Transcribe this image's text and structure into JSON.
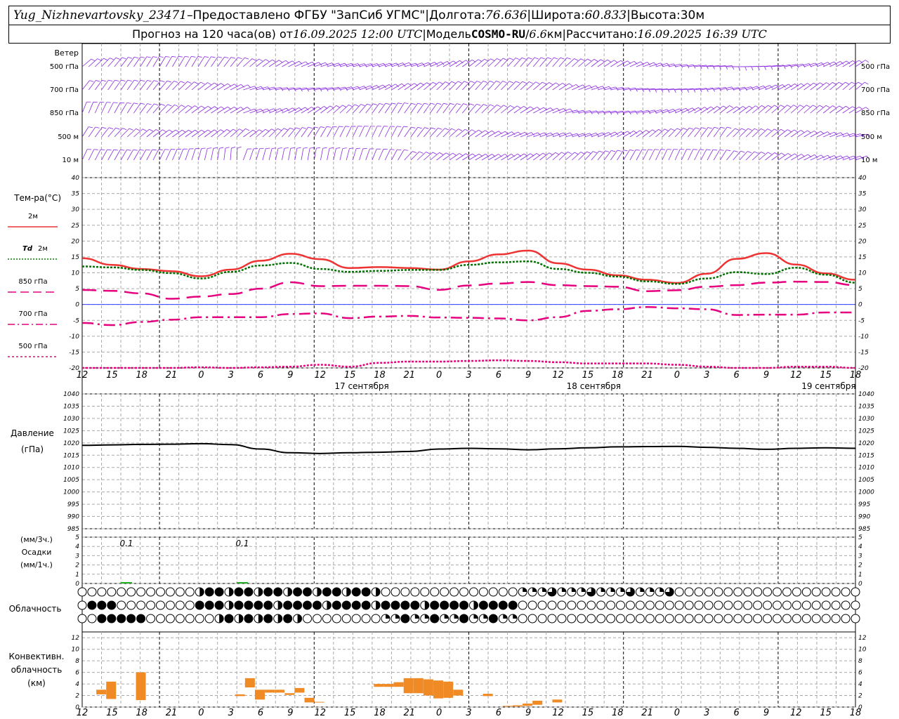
{
  "header": {
    "station": "Yug_Nizhnevartovsky_23471",
    "dash": " – ",
    "provided": "Предоставлено ФГБУ \"ЗапСиб УГМС\"",
    "sep": " | ",
    "lon_label": "Долгота: ",
    "lon": "76.636",
    "lat_label": "Широта: ",
    "lat": "60.833",
    "alt_label": "Высота: ",
    "alt": "30м",
    "forecast_label": "Прогноз на 120 часа(ов) от ",
    "init_time": "16.09.2025 12:00 UTC",
    "model_label": "Модель ",
    "model": "COSMO-RU",
    "res_sep": " / ",
    "res": "6.6",
    "res_unit": "км",
    "calc_label": "Рассчитано: ",
    "calc_time": "16.09.2025 16:39 UTC"
  },
  "wind_panel": {
    "title": "Ветер",
    "levels": [
      "500 гПа",
      "700 гПа",
      "850 гПа",
      "500 м",
      "10 м"
    ],
    "color": "#8a2be2"
  },
  "time_axis": {
    "hour_labels": [
      "12",
      "15",
      "18",
      "21",
      "0",
      "3",
      "6",
      "9",
      "12",
      "15",
      "18",
      "21",
      "0",
      "3",
      "6",
      "9",
      "12",
      "15",
      "18",
      "21",
      "0",
      "3",
      "6",
      "9",
      "12",
      "15",
      "18"
    ],
    "dates": [
      "17 сентября",
      "18 сентября",
      "19 сентября"
    ]
  },
  "temp_panel": {
    "title": "Тем-ра(°C)",
    "legend": [
      {
        "label": "2м",
        "color": "#ee3333",
        "dash": "solid"
      },
      {
        "label_it": "Td",
        "label": "2м",
        "color": "#008000",
        "dash": "dotted"
      },
      {
        "label": "850 гПа",
        "color": "#e6007e",
        "dash": "long"
      },
      {
        "label": "700 гПа",
        "color": "#e6007e",
        "dash": "dashdot"
      },
      {
        "label": "500 гПа",
        "color": "#e6007e",
        "dash": "dot"
      }
    ],
    "yticks": [
      40,
      35,
      30,
      25,
      20,
      15,
      10,
      5,
      0,
      -5,
      -10,
      -15,
      -20
    ]
  },
  "pressure_panel": {
    "title": "Давление",
    "unit": "(гПа)",
    "yticks": [
      1040,
      1035,
      1030,
      1025,
      1020,
      1015,
      1010,
      1005,
      1000,
      995,
      990,
      985
    ]
  },
  "precip_panel": {
    "unit_top": "(мм/3ч.)",
    "title": "Осадки",
    "unit_bottom": "(мм/1ч.)",
    "yticks": [
      5,
      4,
      3,
      2,
      1,
      0
    ],
    "annotations": [
      "0.1",
      "0.1"
    ]
  },
  "cloud_panel": {
    "title": "Облачность"
  },
  "conv_panel": {
    "title_1": "Конвективн.",
    "title_2": "облачность",
    "unit": "(км)",
    "yticks": [
      12,
      10,
      8,
      6,
      4,
      2,
      0
    ]
  },
  "chart_data": [
    {
      "type": "line",
      "title": "Тем-ра(°C)",
      "x": [
        "16.09 12",
        "16.09 15",
        "16.09 18",
        "16.09 21",
        "17.09 00",
        "17.09 03",
        "17.09 06",
        "17.09 09",
        "17.09 12",
        "17.09 15",
        "17.09 18",
        "17.09 21",
        "18.09 00",
        "18.09 03",
        "18.09 06",
        "18.09 09",
        "18.09 12",
        "18.09 15",
        "18.09 18",
        "18.09 21",
        "19.09 00",
        "19.09 03",
        "19.09 06",
        "19.09 09",
        "19.09 12",
        "19.09 15",
        "19.09 18"
      ],
      "ylim": [
        -20,
        40
      ],
      "series": [
        {
          "name": "2м",
          "values": [
            14.6,
            12.5,
            11.2,
            10.5,
            8.9,
            11.0,
            13.8,
            16.0,
            14.3,
            11.5,
            11.8,
            11.5,
            11.0,
            13.6,
            15.8,
            17.0,
            13.0,
            11.0,
            9.2,
            7.8,
            6.8,
            9.7,
            14.4,
            16.2,
            12.6,
            9.8,
            7.8
          ]
        },
        {
          "name": "Td 2м",
          "values": [
            12.0,
            11.7,
            10.9,
            9.9,
            8.2,
            10.3,
            12.3,
            13.1,
            11.2,
            10.3,
            10.6,
            10.9,
            10.9,
            12.5,
            13.3,
            13.6,
            11.2,
            10.0,
            8.8,
            7.3,
            6.5,
            8.2,
            10.2,
            9.6,
            11.6,
            9.4,
            6.9
          ]
        },
        {
          "name": "850 гПа",
          "values": [
            4.6,
            4.3,
            3.5,
            1.8,
            2.5,
            3.3,
            5.0,
            7.0,
            5.8,
            5.9,
            5.9,
            5.8,
            4.6,
            6.0,
            6.6,
            7.1,
            6.1,
            5.8,
            5.6,
            4.2,
            4.5,
            5.6,
            6.1,
            6.9,
            7.2,
            7.1,
            6.1
          ]
        },
        {
          "name": "700 гПа",
          "values": [
            -5.8,
            -6.5,
            -5.5,
            -4.8,
            -4.0,
            -4.0,
            -4.0,
            -3.0,
            -2.8,
            -4.3,
            -3.8,
            -3.6,
            -4.1,
            -4.2,
            -4.4,
            -5.0,
            -4.0,
            -2.0,
            -1.5,
            -0.8,
            -1.2,
            -1.5,
            -3.3,
            -3.2,
            -3.2,
            -2.5,
            -2.5
          ]
        },
        {
          "name": "500 гПа",
          "values": [
            -20,
            -20,
            -20,
            -20,
            -19.8,
            -20,
            -19.8,
            -19.6,
            -19.0,
            -19.6,
            -18.4,
            -18.0,
            -18.0,
            -17.8,
            -17.6,
            -17.8,
            -18.2,
            -18.6,
            -18.6,
            -18.6,
            -19.0,
            -19.6,
            -20,
            -20,
            -19.6,
            -19.6,
            -20
          ]
        }
      ]
    },
    {
      "type": "line",
      "title": "Давление",
      "ylim": [
        985,
        1040
      ],
      "series": [
        {
          "name": "Давление",
          "values": [
            1019.0,
            1019.2,
            1019.4,
            1019.5,
            1019.7,
            1019.3,
            1017.5,
            1016.0,
            1015.7,
            1016.0,
            1016.2,
            1016.5,
            1017.5,
            1017.8,
            1017.6,
            1017.2,
            1017.6,
            1018.0,
            1018.4,
            1018.5,
            1018.6,
            1018.2,
            1017.8,
            1017.4,
            1017.8,
            1018.0,
            1017.8
          ]
        }
      ]
    },
    {
      "type": "bar",
      "title": "Осадки",
      "ylim": [
        0,
        5
      ],
      "bars_3h": [
        {
          "x": "16.09 18",
          "value": 0.1,
          "label": "0.1"
        },
        {
          "x": "17.09 06",
          "value": 0.1,
          "label": "0.1"
        }
      ]
    },
    {
      "type": "bar",
      "title": "Конвективн. облачность",
      "ylim": [
        0,
        13
      ],
      "bars": [
        {
          "x_hour": 1,
          "bottom": 2.2,
          "top": 3.0
        },
        {
          "x_hour": 2,
          "bottom": 1.4,
          "top": 4.4
        },
        {
          "x_hour": 5,
          "bottom": 1.2,
          "top": 6.0
        },
        {
          "x_hour": 15,
          "bottom": 1.9,
          "top": 2.2
        },
        {
          "x_hour": 16,
          "bottom": 3.4,
          "top": 5.0
        },
        {
          "x_hour": 17,
          "bottom": 1.3,
          "top": 3.0
        },
        {
          "x_hour": 18,
          "bottom": 2.5,
          "top": 3.0
        },
        {
          "x_hour": 19,
          "bottom": 2.5,
          "top": 3.0
        },
        {
          "x_hour": 20,
          "bottom": 2.1,
          "top": 2.4
        },
        {
          "x_hour": 21,
          "bottom": 2.5,
          "top": 3.3
        },
        {
          "x_hour": 22,
          "bottom": 0.8,
          "top": 1.6
        },
        {
          "x_hour": 23,
          "bottom": 0.8,
          "top": 0.9
        },
        {
          "x_hour": 29,
          "bottom": 3.5,
          "top": 4.0
        },
        {
          "x_hour": 30,
          "bottom": 3.5,
          "top": 4.0
        },
        {
          "x_hour": 31,
          "bottom": 3.5,
          "top": 4.3
        },
        {
          "x_hour": 32,
          "bottom": 2.4,
          "top": 5.0
        },
        {
          "x_hour": 33,
          "bottom": 2.4,
          "top": 5.0
        },
        {
          "x_hour": 34,
          "bottom": 2.0,
          "top": 4.8
        },
        {
          "x_hour": 35,
          "bottom": 1.5,
          "top": 4.6
        },
        {
          "x_hour": 36,
          "bottom": 1.6,
          "top": 4.4
        },
        {
          "x_hour": 37,
          "bottom": 2.0,
          "top": 3.0
        },
        {
          "x_hour": 40,
          "bottom": 1.9,
          "top": 2.3
        },
        {
          "x_hour": 42,
          "bottom": 0.1,
          "top": 0.2
        },
        {
          "x_hour": 43,
          "bottom": 0.1,
          "top": 0.3
        },
        {
          "x_hour": 44,
          "bottom": 0.2,
          "top": 0.6
        },
        {
          "x_hour": 45,
          "bottom": 0.4,
          "top": 1.1
        },
        {
          "x_hour": 47,
          "bottom": 0.8,
          "top": 1.3
        }
      ]
    }
  ]
}
